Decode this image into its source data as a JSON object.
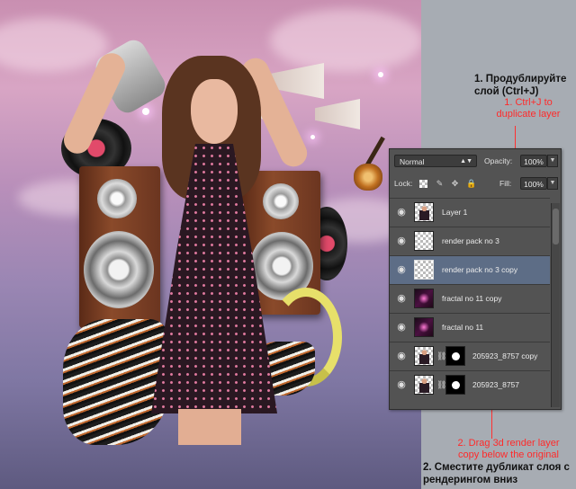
{
  "annotations": {
    "step1_ru_line1": "1. Продублируйте",
    "step1_ru_line2": "слой (Ctrl+J)",
    "step1_en_line1": "1. Ctrl+J to",
    "step1_en_line2": "duplicate layer",
    "step2_en_line1": "2. Drag 3d render layer",
    "step2_en_line2": "copy  below the original",
    "step2_ru_line1": "2. Сместите дубликат слоя с",
    "step2_ru_line2": "рендерингом вниз"
  },
  "layers_panel": {
    "blend_mode": "Normal",
    "opacity_label": "Opacity:",
    "opacity_value": "100%",
    "lock_label": "Lock:",
    "fill_label": "Fill:",
    "fill_value": "100%",
    "lock_icons": [
      "checkerboard-lock-icon",
      "brush-lock-icon",
      "move-lock-icon",
      "padlock-icon"
    ],
    "layers": [
      {
        "name": "Layer 1",
        "thumb": "figure",
        "selected": false,
        "mask": false
      },
      {
        "name": "render pack no 3",
        "thumb": "transparent",
        "selected": false,
        "mask": false
      },
      {
        "name": "render pack no 3 copy",
        "thumb": "transparent",
        "selected": true,
        "mask": false
      },
      {
        "name": "fractal no 11 copy",
        "thumb": "fractal",
        "selected": false,
        "mask": false
      },
      {
        "name": "fractal no 11",
        "thumb": "fractal",
        "selected": false,
        "mask": false
      },
      {
        "name": "205923_8757 copy",
        "thumb": "figure",
        "selected": false,
        "mask": true
      },
      {
        "name": "205923_8757",
        "thumb": "figure",
        "selected": false,
        "mask": true
      }
    ]
  },
  "colors": {
    "annotation_red": "#ff2a2a",
    "panel_bg": "#535353",
    "selected_layer": "#5d6d86"
  }
}
